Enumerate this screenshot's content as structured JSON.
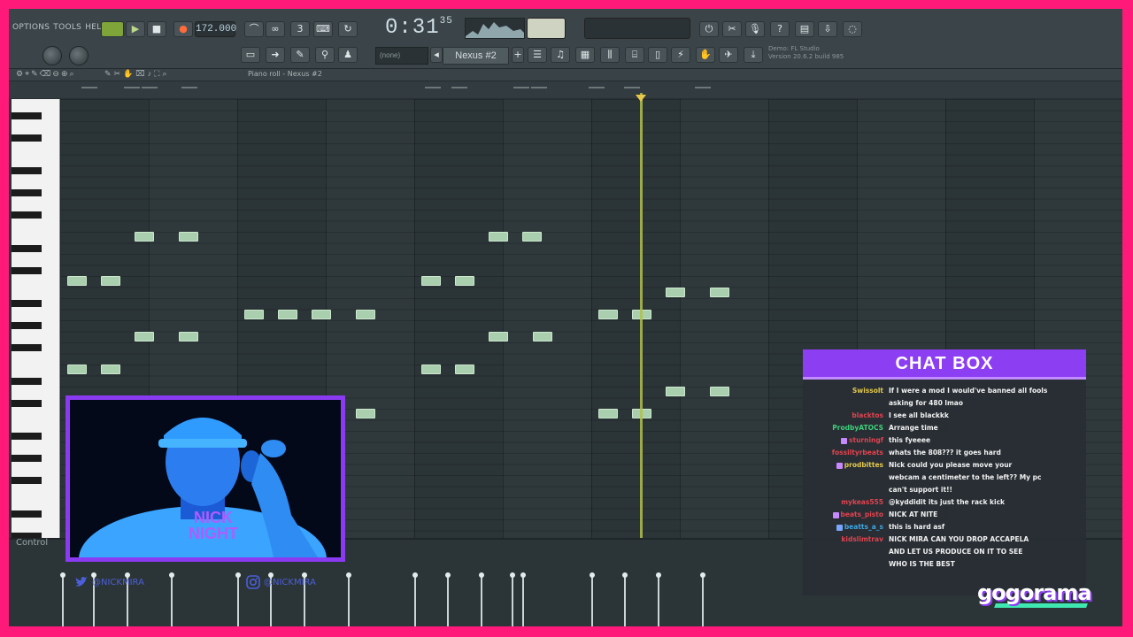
{
  "toolbar": {
    "menu": [
      "OPTIONS",
      "TOOLS",
      "HELP"
    ],
    "tempo": "172.000",
    "time_main": "0:31",
    "time_sub": "35",
    "pattern": "Nexus #2",
    "snap": "(none)",
    "hint_line1": "Demo: FL Studio",
    "hint_line2": "Version 20.6.2 build 985",
    "icons": [
      "play-icon",
      "stop-icon",
      "record-icon",
      "metronome-icon",
      "cpu-icon",
      "mixer-icon",
      "browser-icon",
      "plugin-icon",
      "help-icon"
    ]
  },
  "piano_roll": {
    "title": "Piano roll - Nexus #2"
  },
  "control": {
    "label": "Control"
  },
  "socials": {
    "twitter": "@NICKMIRA",
    "instagram": "@NICKMIRA"
  },
  "webcam": {
    "shirt_text1": "NICK",
    "shirt_text2": "NIGHT"
  },
  "chat": {
    "title": "CHAT BOX",
    "lines": [
      {
        "user": "Swissolt",
        "color": "#e3c84b",
        "badge": "",
        "msg": "If I were a mod I would've banned all fools"
      },
      {
        "user": "",
        "color": "#e3c84b",
        "badge": "",
        "msg": "asking for 480 lmao"
      },
      {
        "user": "blacktos",
        "color": "#e0434f",
        "badge": "",
        "msg": "I see all blackkk"
      },
      {
        "user": "ProdbyATOCS",
        "color": "#3fd07a",
        "badge": "",
        "msg": "Arrange time"
      },
      {
        "user": "sturningf",
        "color": "#e0434f",
        "badge": "#c889ff",
        "msg": "this fyeeee"
      },
      {
        "user": "fossiltyrbeats",
        "color": "#e0434f",
        "badge": "",
        "msg": "whats the 808??? it goes hard"
      },
      {
        "user": "prodbittes",
        "color": "#e3c84b",
        "badge": "#c889ff",
        "msg": "Nick could you please move your"
      },
      {
        "user": "",
        "color": "#e3c84b",
        "badge": "",
        "msg": "webcam a centimeter to the left?? My pc"
      },
      {
        "user": "",
        "color": "#e3c84b",
        "badge": "",
        "msg": "can't support it!!"
      },
      {
        "user": "mykeas555",
        "color": "#e0434f",
        "badge": "",
        "msg": "@kyddidit its just the rack kick"
      },
      {
        "user": "beats_pisto",
        "color": "#e0434f",
        "badge": "#c889ff",
        "msg": "NICK AT NITE"
      },
      {
        "user": "beatts_a_s",
        "color": "#3fa5e0",
        "badge": "#7aa6ff",
        "msg": "this is hard asf"
      },
      {
        "user": "kidslimtrav",
        "color": "#e0434f",
        "badge": "",
        "msg": "NICK MIRA CAN YOU DROP ACCAPELA"
      },
      {
        "user": "",
        "color": "#e0434f",
        "badge": "",
        "msg": "AND LET US PRODUCE ON IT TO SEE"
      },
      {
        "user": "",
        "color": "#e0434f",
        "badge": "",
        "msg": "WHO IS THE BEST"
      }
    ]
  },
  "logo": {
    "text": "gogorama"
  },
  "notes": [
    {
      "bar": 0.08,
      "row": 16
    },
    {
      "bar": 0.46,
      "row": 16
    },
    {
      "bar": 0.84,
      "row": 12
    },
    {
      "bar": 1.34,
      "row": 12
    },
    {
      "bar": 0.84,
      "row": 21
    },
    {
      "bar": 1.34,
      "row": 21
    },
    {
      "bar": 0.08,
      "row": 24
    },
    {
      "bar": 0.46,
      "row": 24
    },
    {
      "bar": 2.08,
      "row": 19
    },
    {
      "bar": 2.46,
      "row": 19
    },
    {
      "bar": 2.84,
      "row": 19
    },
    {
      "bar": 3.34,
      "row": 19
    },
    {
      "bar": 3.34,
      "row": 28
    },
    {
      "bar": 4.08,
      "row": 16
    },
    {
      "bar": 4.46,
      "row": 16
    },
    {
      "bar": 4.84,
      "row": 12
    },
    {
      "bar": 5.22,
      "row": 12
    },
    {
      "bar": 4.84,
      "row": 21
    },
    {
      "bar": 5.34,
      "row": 21
    },
    {
      "bar": 4.08,
      "row": 24
    },
    {
      "bar": 4.46,
      "row": 24
    },
    {
      "bar": 6.08,
      "row": 19
    },
    {
      "bar": 6.46,
      "row": 19
    },
    {
      "bar": 6.08,
      "row": 28
    },
    {
      "bar": 6.46,
      "row": 28
    },
    {
      "bar": 6.84,
      "row": 17
    },
    {
      "bar": 7.34,
      "row": 17
    },
    {
      "bar": 6.84,
      "row": 26
    },
    {
      "bar": 7.34,
      "row": 26
    }
  ],
  "velocities": [
    {
      "bar": 0.02,
      "level": 0.8
    },
    {
      "bar": 0.37,
      "level": 0.8
    },
    {
      "bar": 0.75,
      "level": 0.8
    },
    {
      "bar": 1.25,
      "level": 0.8
    },
    {
      "bar": 2.0,
      "level": 0.8
    },
    {
      "bar": 2.37,
      "level": 0.8
    },
    {
      "bar": 2.75,
      "level": 0.8
    },
    {
      "bar": 3.25,
      "level": 0.8
    },
    {
      "bar": 4.0,
      "level": 0.8
    },
    {
      "bar": 4.37,
      "level": 0.8
    },
    {
      "bar": 4.75,
      "level": 0.8
    },
    {
      "bar": 5.1,
      "level": 0.8
    },
    {
      "bar": 5.22,
      "level": 0.8
    },
    {
      "bar": 6.0,
      "level": 0.8
    },
    {
      "bar": 6.37,
      "level": 0.8
    },
    {
      "bar": 6.75,
      "level": 0.8
    },
    {
      "bar": 7.25,
      "level": 0.8
    }
  ]
}
